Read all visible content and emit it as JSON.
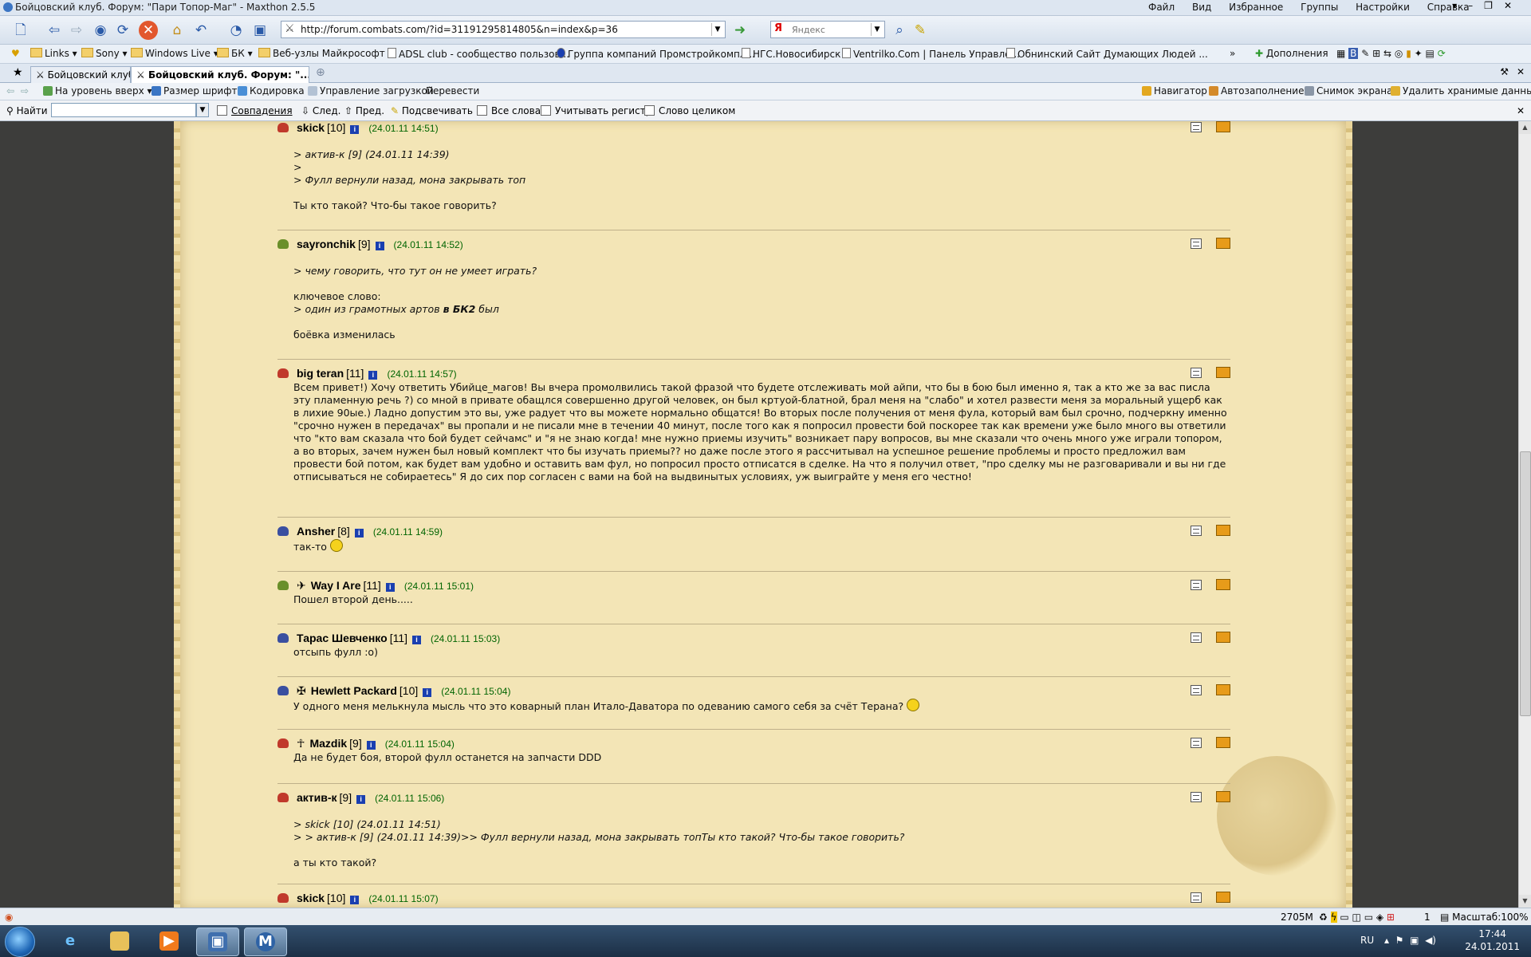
{
  "window": {
    "title": "Бойцовский клуб. Форум: \"Пари Топор-Маг\" - Maxthon 2.5.5",
    "menu": [
      "Файл",
      "Вид",
      "Избранное",
      "Группы",
      "Настройки",
      "Справка"
    ]
  },
  "address": {
    "url": "http://forum.combats.com/?id=31191295814805&n=index&p=36"
  },
  "search": {
    "placeholder": "Яндекс"
  },
  "favorites": [
    {
      "label": "Links",
      "type": "folder"
    },
    {
      "label": "Sony",
      "type": "folder"
    },
    {
      "label": "Windows Live",
      "type": "folder"
    },
    {
      "label": "БК",
      "type": "folder"
    },
    {
      "label": "Веб-узлы Майкрософт",
      "type": "folder"
    },
    {
      "label": "ADSL club - сообщество пользов...",
      "type": "page"
    },
    {
      "label": "Группа компаний Промстройкомпл...",
      "type": "page"
    },
    {
      "label": "НГС.Новосибирск",
      "type": "page"
    },
    {
      "label": "Ventrilko.Com | Панель Управле...",
      "type": "page"
    },
    {
      "label": "Обнинский Сайт Думающих Людей ...",
      "type": "page"
    }
  ],
  "favorites_right": {
    "addons": "Дополнения"
  },
  "tabs": [
    {
      "label": "Бойцовский клуб",
      "active": false
    },
    {
      "label": "Бойцовский клуб. Форум: \"...",
      "active": true
    }
  ],
  "tools": {
    "up_level": "На уровень вверх",
    "font_size": "Размер шрифта",
    "encoding": "Кодировка",
    "downloads": "Управление загрузкой",
    "translate": "Перевести",
    "navigator": "Навигатор",
    "autofill": "Автозаполнение",
    "screenshot": "Снимок экрана",
    "clear_data": "Удалить хранимые данные..."
  },
  "find": {
    "label": "Найти",
    "matches": "Совпадения",
    "next": "След.",
    "prev": "Пред.",
    "highlight": "Подсвечивать",
    "all_words": "Все слова",
    "match_case": "Учитывать регистр",
    "whole_word": "Слово целиком"
  },
  "posts": [
    {
      "nick": "skick",
      "level": "[10]",
      "date": "24.01.11 14:51",
      "clan_color": "#c0392b",
      "align_icon": "",
      "lines": [
        {
          "text": "> актив-к [9] (24.01.11 14:39)",
          "quote": true
        },
        {
          "text": ">",
          "quote": true
        },
        {
          "text": "> Фулл вернули назад, мона закрывать топ",
          "quote": true
        },
        {
          "text": "",
          "quote": false
        },
        {
          "text": "Ты кто такой? Что-бы такое говорить?",
          "quote": false
        }
      ]
    },
    {
      "nick": "sayronchik",
      "level": "[9]",
      "date": "24.01.11 14:52",
      "clan_color": "#6a8f2a",
      "align_icon": "",
      "lines": [
        {
          "text": "> чему говорить, что тут он не умеет играть?",
          "quote": true
        },
        {
          "text": "",
          "quote": false
        },
        {
          "text": "ключевое слово:",
          "quote": false
        },
        {
          "text": "> один из грамотных артов ",
          "quote": true,
          "bold": "в БК2",
          "tail": " был"
        },
        {
          "text": "",
          "quote": false
        },
        {
          "text": "боёвка изменилась",
          "quote": false
        }
      ]
    },
    {
      "nick": "big teran",
      "level": "[11]",
      "date": "24.01.11 14:57",
      "clan_color": "#c0392b",
      "align_icon": "",
      "paragraph": "Всем привет!) Хочу ответить Убийце_магов! Вы вчера промолвились такой фразой что будете отслеживать мой айпи, что бы в бою был именно я, так а кто же за вас писла эту пламенную речь ?) со мной в привате обащлся совершенно другой человек, он был кртуой-блатной, брал меня на \"слабо\" и хотел развести меня за моральный ущерб как в лихие 90ые.) Ладно допустим это вы, уже радует что вы можете нормально общатся! Во вторых после получения от меня фула, который вам был срочно, подчеркну именно \"срочно нужен в передачах\" вы пропали и не писали мне в течении 40 минут, после того как я попросил провести бой поскорее так как времени уже было много вы ответили что \"кто вам сказала что бой будет сейчамс\" и \"я не знаю когда! мне нужно приемы изучить\" возникает пару вопросов, вы мне сказали что очень много уже играли топором, а во вторых, зачем нужен был новый комплект что бы изучать приемы?? но даже после этого я рассчитывал на успешное решение проблемы и просто предложил вам провести бой потом, как будет вам удобно и оставить вам фул, но попросил просто отписатся в сделке. На что я получил ответ, \"про сделку мы не разговаривали и вы ни где отписываться не собираетесь\" Я до сих пор согласен с вами на бой на выдвинытых условиях, уж выиграйте у меня его честно!"
    },
    {
      "nick": "Ansher",
      "level": "[8]",
      "date": "24.01.11 14:59",
      "clan_color": "#3a4fa0",
      "align_icon": "",
      "lines": [
        {
          "text": "так-то ",
          "quote": false,
          "smile": true
        }
      ]
    },
    {
      "nick": "Way I Are",
      "level": "[11]",
      "date": "24.01.11 15:01",
      "clan_color": "#6a8f2a",
      "align_icon": "✈",
      "lines": [
        {
          "text": "Пошел второй день.....",
          "quote": false
        }
      ]
    },
    {
      "nick": "Тарас Шевченко",
      "level": "[11]",
      "date": "24.01.11 15:03",
      "clan_color": "#3a4fa0",
      "align_icon": "",
      "lines": [
        {
          "text": "отсыпь фулл :о)",
          "quote": false
        }
      ]
    },
    {
      "nick": "Hewlett Packard",
      "level": "[10]",
      "date": "24.01.11 15:04",
      "clan_color": "#3a4fa0",
      "align_icon": "✠",
      "lines": [
        {
          "text": "У одного меня мелькнула мысль что это коварный план Итало-Даватора по одеванию самого себя за счёт Терана? ",
          "quote": false,
          "smile": true
        }
      ]
    },
    {
      "nick": "Mazdik",
      "level": "[9]",
      "date": "24.01.11 15:04",
      "clan_color": "#c0392b",
      "align_icon": "☥",
      "lines": [
        {
          "text": "Да не будет боя, второй фулл останется на запчасти DDD",
          "quote": false
        }
      ]
    },
    {
      "nick": "актив-к",
      "level": "[9]",
      "date": "24.01.11 15:06",
      "clan_color": "#c0392b",
      "align_icon": "",
      "lines": [
        {
          "text": ">   skick [10] (24.01.11 14:51)",
          "quote": true
        },
        {
          "text": "> > актив-к [9] (24.01.11 14:39)>> Фулл вернули назад, мона закрывать топТы кто такой? Что-бы такое говорить?",
          "quote": true
        },
        {
          "text": "",
          "quote": false
        },
        {
          "text": "а ты кто такой?",
          "quote": false
        }
      ]
    },
    {
      "nick": "skick",
      "level": "[10]",
      "date": "24.01.11 15:07",
      "clan_color": "#c0392b",
      "align_icon": "",
      "lines": []
    }
  ],
  "status": {
    "memory": "2705M",
    "counter": "1",
    "zoom": "Масштаб:100%"
  },
  "tray": {
    "lang": "RU",
    "time": "17:44",
    "date": "24.01.2011"
  }
}
